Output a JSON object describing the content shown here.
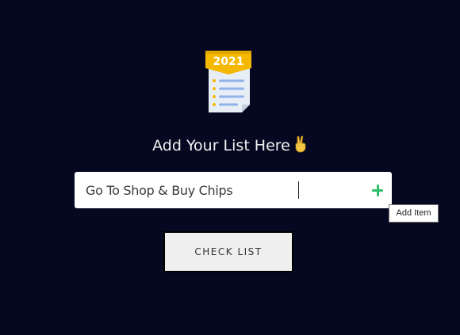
{
  "logo": {
    "badge_text": "2021",
    "icon": "list-document-icon"
  },
  "heading": {
    "text": "Add Your List Here",
    "emoji": "✌"
  },
  "input": {
    "value": "Go To Shop & Buy Chips"
  },
  "add_button": {
    "icon": "plus-icon",
    "tooltip": "Add Item"
  },
  "check_button": {
    "label": "CHECK LIST"
  },
  "colors": {
    "background": "#060822",
    "plus": "#2fbf6a",
    "badge": "#f5b800"
  }
}
